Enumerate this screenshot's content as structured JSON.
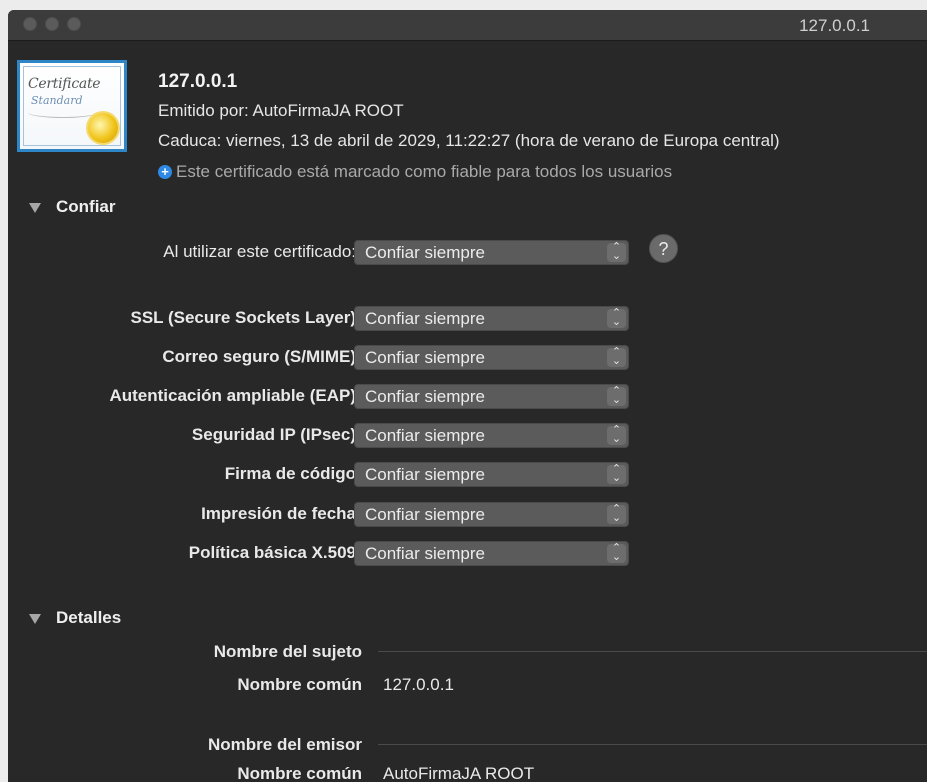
{
  "window": {
    "title": "127.0.0.1"
  },
  "certificate": {
    "icon_text": "Certificate",
    "icon_subtext": "Standard",
    "name": "127.0.0.1",
    "issued_by": "Emitido por: AutoFirmaJA ROOT",
    "expires": "Caduca: viernes, 13 de abril de 2029, 11:22:27 (hora de verano de Europa central)",
    "trust_note": "Este certificado está marcado como fiable para todos los usuarios"
  },
  "trust": {
    "section_title": "Confiar",
    "main_label": "Al utilizar este certificado:",
    "main_value": "Confiar siempre",
    "help_label": "?",
    "policies": [
      {
        "label": "SSL (Secure Sockets Layer)",
        "value": "Confiar siempre"
      },
      {
        "label": "Correo seguro (S/MIME)",
        "value": "Confiar siempre"
      },
      {
        "label": "Autenticación ampliable (EAP)",
        "value": "Confiar siempre"
      },
      {
        "label": "Seguridad IP (IPsec)",
        "value": "Confiar siempre"
      },
      {
        "label": "Firma de código",
        "value": "Confiar siempre"
      },
      {
        "label": "Impresión de fecha",
        "value": "Confiar siempre"
      },
      {
        "label": "Política básica X.509",
        "value": "Confiar siempre"
      }
    ]
  },
  "details": {
    "section_title": "Detalles",
    "subject_heading": "Nombre del sujeto",
    "subject_cn_label": "Nombre común",
    "subject_cn_value": "127.0.0.1",
    "issuer_heading": "Nombre del emisor",
    "issuer_cn_label": "Nombre común",
    "issuer_cn_value": "AutoFirmaJA ROOT"
  }
}
